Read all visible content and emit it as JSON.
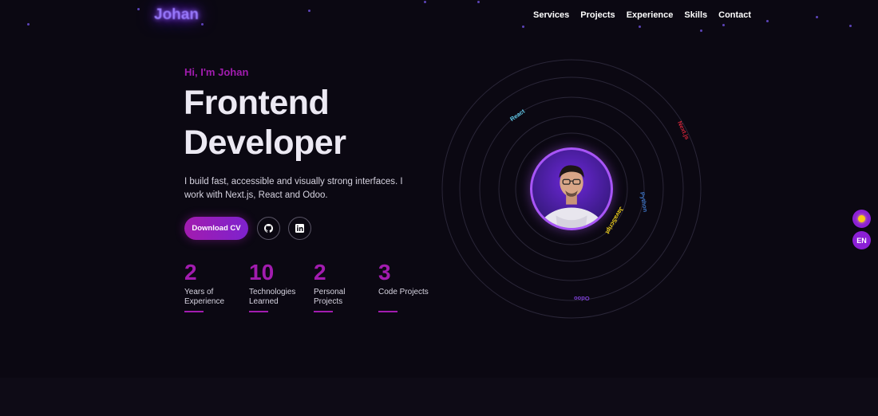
{
  "header": {
    "logo": "Johan",
    "nav": [
      "Services",
      "Projects",
      "Experience",
      "Skills",
      "Contact"
    ]
  },
  "hero": {
    "greeting": "Hi, I'm Johan",
    "title_line1": "Frontend",
    "title_line2": "Developer",
    "description": "I build fast, accessible and visually strong interfaces. I work with Next.js, React and Odoo.",
    "download_label": "Download CV",
    "social": [
      "github-icon",
      "linkedin-icon"
    ]
  },
  "stats": [
    {
      "value": "2",
      "label": "Years of Experience"
    },
    {
      "value": "10",
      "label": "Technologies Learned"
    },
    {
      "value": "2",
      "label": "Personal Projects"
    },
    {
      "value": "3",
      "label": "Code Projects"
    }
  ],
  "orbit": {
    "technologies": [
      {
        "name": "React",
        "color": "#5fc9e8"
      },
      {
        "name": "Next.js",
        "color": "#d0263a"
      },
      {
        "name": "Python",
        "color": "#3d74c4"
      },
      {
        "name": "JavaScript",
        "color": "#f2d21c"
      },
      {
        "name": "Odoo",
        "color": "#7b3fd1"
      }
    ]
  },
  "floating": {
    "theme_icon": "sun-icon",
    "language": "EN"
  },
  "colors": {
    "accent": "#a21caf",
    "background": "#0b0812",
    "logo_glow": "#8b5cf6"
  }
}
